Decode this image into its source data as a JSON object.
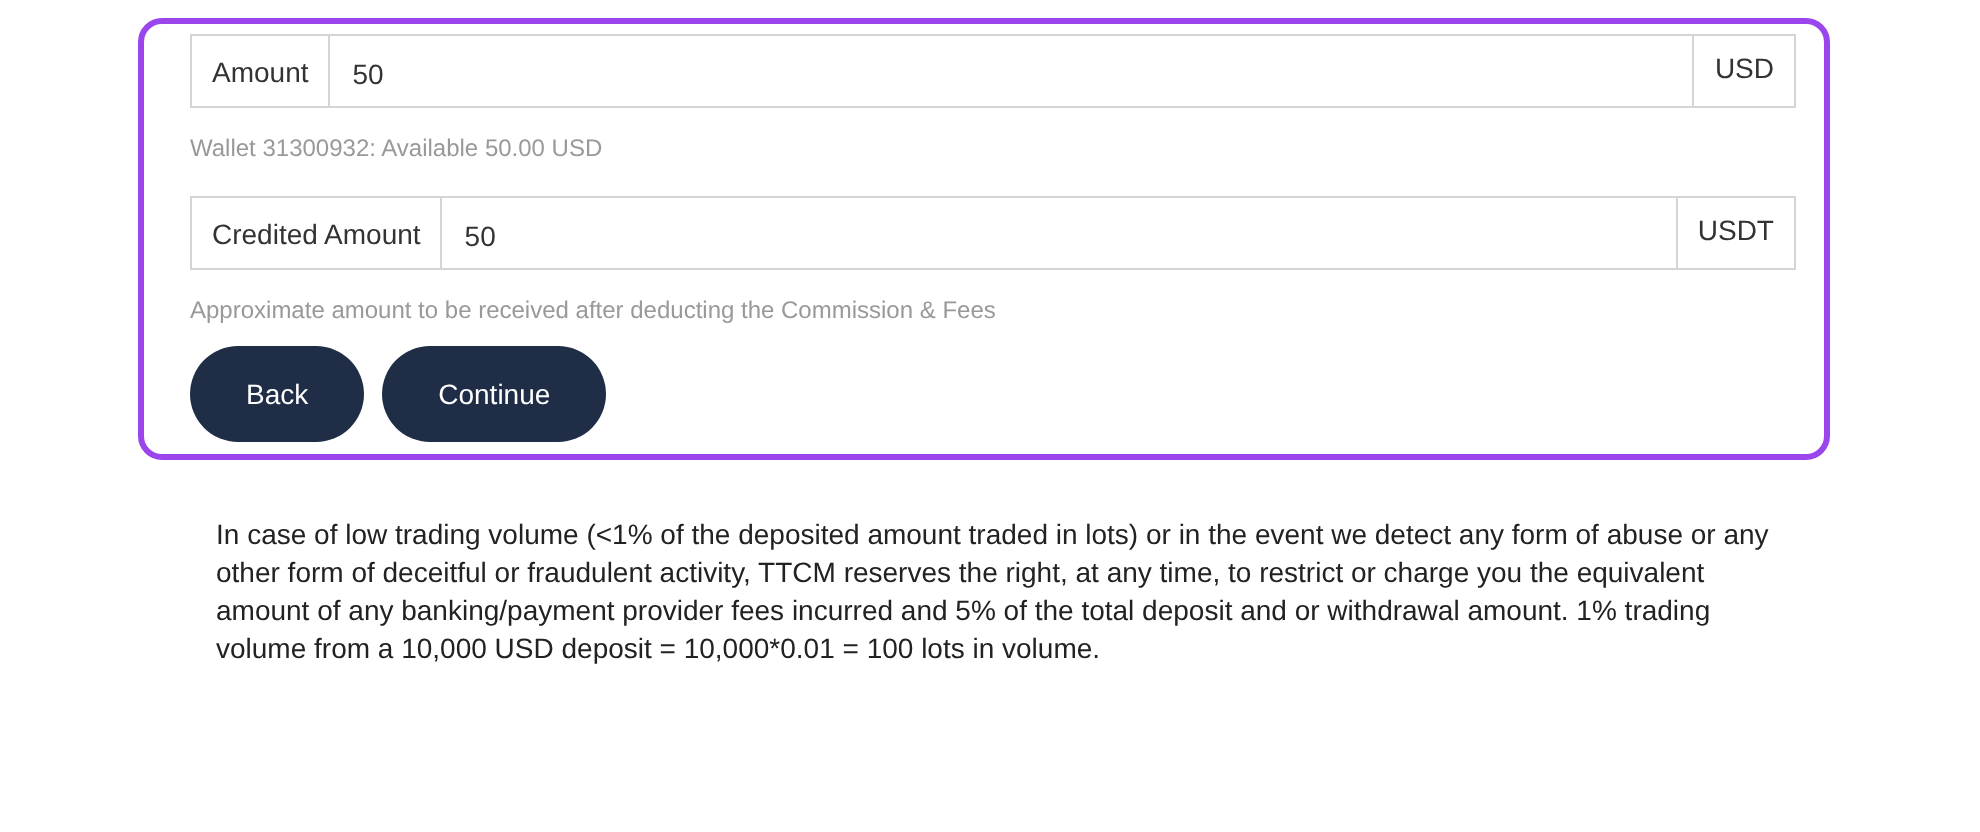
{
  "form": {
    "fields": [
      {
        "label": "Amount",
        "value": "50",
        "unit": "USD",
        "hint": "Wallet 31300932: Available 50.00 USD"
      },
      {
        "label": "Credited Amount",
        "value": "50",
        "unit": "USDT",
        "hint": "Approximate amount to be received after deducting the Commission & Fees"
      }
    ],
    "buttons": [
      "Back",
      "Continue"
    ]
  },
  "notice": "In case of low trading volume (<1% of the deposited amount traded in lots) or in the event we detect any form of abuse or any other form of deceitful or fraudulent activity, TTCM reserves the right, at any time, to restrict or charge you the equivalent amount of any banking/payment provider fees incurred and 5% of the total deposit and or withdrawal amount. 1% trading volume from a 10,000 USD deposit = 10,000*0.01 = 100 lots in volume."
}
